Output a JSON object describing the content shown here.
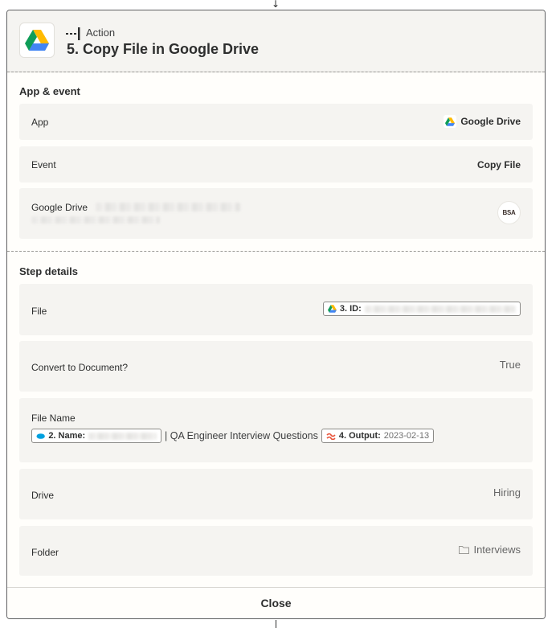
{
  "header": {
    "step_type": "Action",
    "title": "5. Copy File in Google Drive",
    "app_icon": "google-drive-icon",
    "step_type_icon": "action-step-icon"
  },
  "app_event": {
    "section_title": "App & event",
    "app": {
      "label": "App",
      "value": "Google Drive",
      "icon": "google-drive-icon"
    },
    "event": {
      "label": "Event",
      "value": "Copy File"
    },
    "account": {
      "label": "Google Drive",
      "avatar_text": "BSA"
    }
  },
  "step_details": {
    "section_title": "Step details",
    "file": {
      "label": "File",
      "pill_key": "3. ID:",
      "pill_icon": "google-drive-icon"
    },
    "convert": {
      "label": "Convert to Document?",
      "value": "True"
    },
    "file_name": {
      "label": "File Name",
      "name_pill_key": "2. Name:",
      "name_pill_icon": "salesforce-icon",
      "separator_text": "| QA Engineer Interview Questions",
      "output_pill_key": "4. Output:",
      "output_pill_value": "2023-02-13",
      "output_pill_icon": "formatter-icon"
    },
    "drive": {
      "label": "Drive",
      "value": "Hiring"
    },
    "folder": {
      "label": "Folder",
      "value": "Interviews",
      "icon": "folder-icon"
    }
  },
  "footer": {
    "close_label": "Close"
  },
  "colors": {
    "panel_bg": "#fffefb",
    "row_bg": "#f5f4f1",
    "text": "#2d2e2e",
    "border": "#5f6062"
  }
}
